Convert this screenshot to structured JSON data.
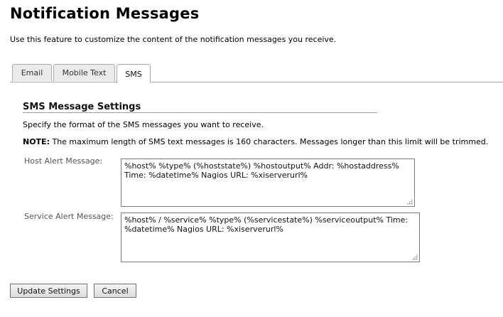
{
  "page": {
    "title": "Notification Messages",
    "intro": "Use this feature to customize the content of the notification messages you receive."
  },
  "tabs": [
    {
      "label": "Email",
      "active": false
    },
    {
      "label": "Mobile Text",
      "active": false
    },
    {
      "label": "SMS",
      "active": true
    }
  ],
  "section": {
    "title": "SMS Message Settings",
    "description": "Specify the format of the SMS messages you want to receive.",
    "note_label": "NOTE:",
    "note_text": " The maximum length of SMS text messages is 160 characters. Messages longer than this limit will be trimmed."
  },
  "fields": {
    "host": {
      "label": "Host Alert Message:",
      "value": "%host% %type% (%hoststate%) %hostoutput% Addr: %hostaddress%  Time: %datetime% Nagios URL: %xiserverurl%"
    },
    "service": {
      "label": "Service Alert Message:",
      "value": "%host% / %service% %type% (%servicestate%) %serviceoutput% Time: %datetime% Nagios URL: %xiserverurl%"
    }
  },
  "buttons": {
    "update": "Update Settings",
    "cancel": "Cancel"
  },
  "colors": {
    "tab_border": "#a8a8a8",
    "inactive_tab_bg": "#ebebeb",
    "label_text": "#555555"
  }
}
